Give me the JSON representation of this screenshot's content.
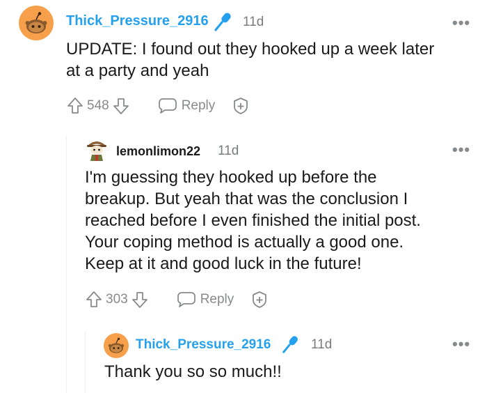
{
  "comments": [
    {
      "author": "Thick_Pressure_2916",
      "is_op": true,
      "badge_icon": "microphone-icon",
      "time": "11d",
      "more_label": "•••",
      "body_lines": [
        "UPDATE: I found out they hooked up a week later",
        "at a party and yeah"
      ],
      "score": "548",
      "reply_label": "Reply"
    },
    {
      "author": "lemonlimon22",
      "is_op": false,
      "time": "11d",
      "more_label": "•••",
      "body_lines": [
        "I'm guessing they hooked up before the",
        "breakup. But yeah that was the conclusion I",
        "reached before I even finished the initial post.",
        "Your coping method is actually a good one.",
        "Keep at it and good luck in the future!"
      ],
      "score": "303",
      "reply_label": "Reply"
    },
    {
      "author": "Thick_Pressure_2916",
      "is_op": true,
      "badge_icon": "microphone-icon",
      "time": "11d",
      "more_label": "•••",
      "body_lines": [
        "Thank you so so much!!"
      ]
    }
  ],
  "colors": {
    "op_name": "#24a0ed",
    "meta": "#787c7e",
    "icon": "#878a8c",
    "avatar_orange": "#f7a04b",
    "thread_line": "#edeff1"
  }
}
